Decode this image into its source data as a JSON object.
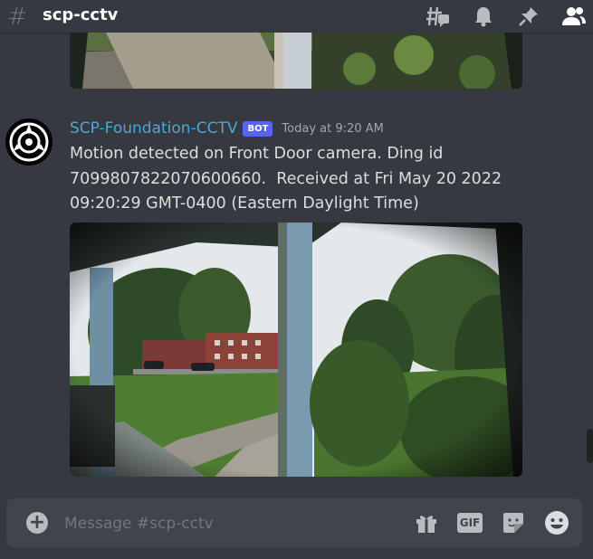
{
  "header": {
    "channel_name": "scp-cctv",
    "icons": [
      "threads-icon",
      "bell-icon",
      "pin-icon",
      "members-icon"
    ]
  },
  "message": {
    "username": "SCP-Foundation-CCTV",
    "bot_tag": "BOT",
    "timestamp": "Today at 9:20 AM",
    "line1": "Motion detected on Front Door camera. Ding id",
    "line2": "7099807822070600660.  Received at Fri May 20 2022",
    "line3": "09:20:29 GMT-0400 (Eastern Daylight Time)"
  },
  "composer": {
    "placeholder": "Message #scp-cctv",
    "gif_label": "GIF",
    "icons": [
      "add-icon",
      "gift-icon",
      "gif-icon",
      "sticker-icon",
      "emoji-icon"
    ]
  },
  "colors": {
    "background": "#36393f",
    "username": "#4ea7d6",
    "bot_tag": "#5865f2",
    "composer": "#40444b"
  }
}
